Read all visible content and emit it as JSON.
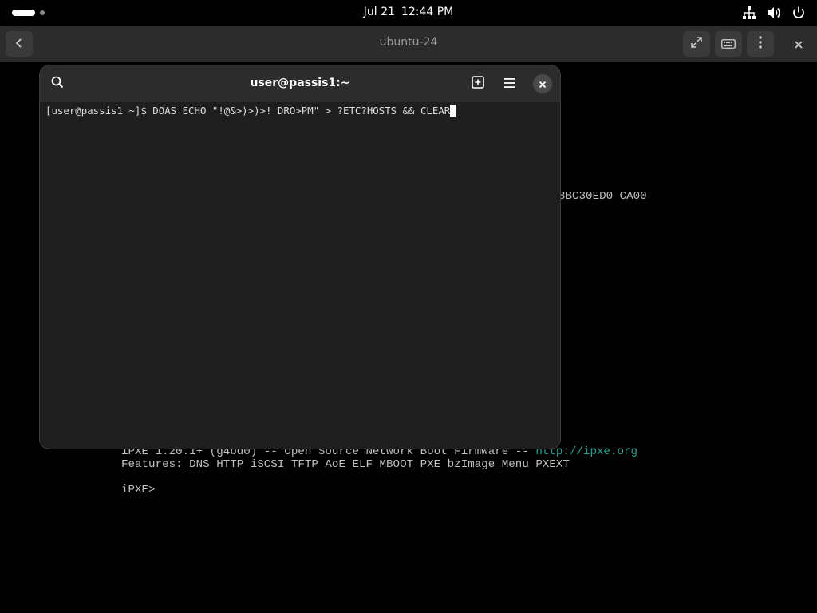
{
  "topbar": {
    "date": "Jul 21",
    "time": "12:44 PM",
    "icons": [
      "network-icon",
      "volume-icon",
      "power-icon"
    ]
  },
  "viewer": {
    "title": "ubuntu-24",
    "buttons": [
      "back-icon",
      "fullscreen-icon",
      "keyboard-icon",
      "menu-dots-icon",
      "close-icon"
    ]
  },
  "console": {
    "partial_line": "8BC30ED0 CA00",
    "banner_prefix": "iPXE 1.20.1+ (g4bd0) -- Open Source Network Boot Firmware -- ",
    "banner_link": "http://ipxe.org",
    "features": "Features: DNS HTTP iSCSI TFTP AoE ELF MBOOT PXE bzImage Menu PXEXT",
    "prompt": "iPXE>"
  },
  "terminal": {
    "title": "user@passis1:~",
    "command_line": "[user@passis1 ~]$ DOAS ECHO \"!@&>)>)>! DRO>PM\" > ?ETC?HOSTS && CLEAR",
    "icons": [
      "search-icon",
      "new-tab-icon",
      "hamburger-menu-icon",
      "close-icon"
    ]
  },
  "colors": {
    "link": "#2aa198",
    "console_text": "#c0c0c0",
    "terminal_bg": "#1e1e1e",
    "header_bg": "#2c2c2c"
  }
}
